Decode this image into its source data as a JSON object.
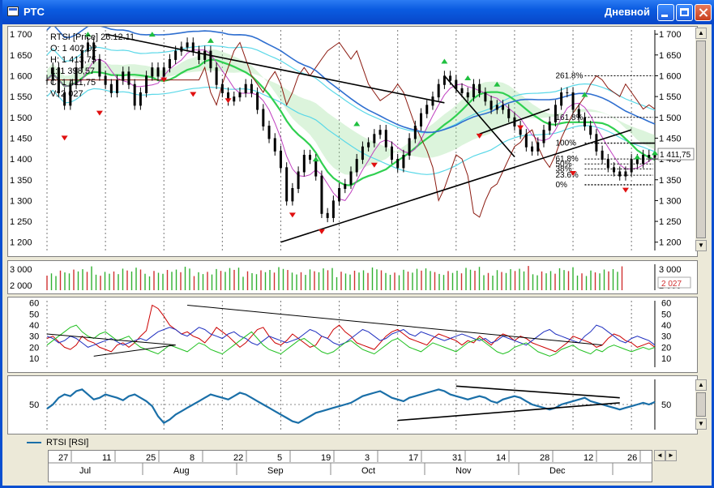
{
  "window": {
    "title": "РТС",
    "period": "Дневной"
  },
  "legend": {
    "rsi": "RTSI [RSI]"
  },
  "chart_data": [
    {
      "type": "candlestick",
      "title": "RTSI [Price] 26.12.11",
      "ohlc": {
        "O": "1 402,02",
        "H": "1 413,75",
        "L": "1 398,57",
        "C": "1 411,75",
        "V": "2 027"
      },
      "ylim": [
        1180,
        1710
      ],
      "yticks": [
        1200,
        1250,
        1300,
        1350,
        1400,
        1450,
        1500,
        1550,
        1600,
        1650,
        1700
      ],
      "ytick_labels": [
        "1 200",
        "1 250",
        "1 300",
        "1 350",
        "1 400",
        "1 450",
        "1 500",
        "1 550",
        "1 600",
        "1 650",
        "1 700"
      ],
      "last_value_label": "1 411,75",
      "last_value": 1411.75,
      "fib_levels": [
        {
          "label": "261.8%",
          "value": 1600
        },
        {
          "label": "161.8%",
          "value": 1500
        },
        {
          "label": "100%",
          "value": 1438
        },
        {
          "label": "61.8%",
          "value": 1400
        },
        {
          "label": "50%",
          "value": 1388
        },
        {
          "label": "38%",
          "value": 1376
        },
        {
          "label": "23.6%",
          "value": 1361
        },
        {
          "label": "0%",
          "value": 1338
        }
      ],
      "closes": [
        1590,
        1620,
        1560,
        1530,
        1580,
        1620,
        1660,
        1680,
        1640,
        1600,
        1580,
        1560,
        1590,
        1610,
        1580,
        1530,
        1560,
        1600,
        1620,
        1600,
        1620,
        1640,
        1660,
        1670,
        1680,
        1660,
        1640,
        1660,
        1620,
        1580,
        1560,
        1540,
        1550,
        1560,
        1580,
        1560,
        1520,
        1480,
        1450,
        1420,
        1380,
        1300,
        1330,
        1370,
        1410,
        1400,
        1360,
        1270,
        1260,
        1300,
        1330,
        1340,
        1370,
        1400,
        1430,
        1440,
        1460,
        1470,
        1430,
        1400,
        1380,
        1410,
        1450,
        1480,
        1510,
        1530,
        1550,
        1580,
        1600,
        1590,
        1570,
        1560,
        1550,
        1580,
        1560,
        1540,
        1520,
        1530,
        1520,
        1500,
        1480,
        1460,
        1430,
        1420,
        1440,
        1470,
        1490,
        1530,
        1560,
        1560,
        1520,
        1500,
        1480,
        1460,
        1420,
        1400,
        1380,
        1370,
        1360,
        1370,
        1400,
        1390,
        1410,
        1405,
        1412
      ],
      "signals": [
        {
          "dir": "up",
          "i": 7,
          "value": 1700
        },
        {
          "dir": "down",
          "i": 3,
          "value": 1450
        },
        {
          "dir": "down",
          "i": 9,
          "value": 1510
        },
        {
          "dir": "up",
          "i": 18,
          "value": 1700
        },
        {
          "dir": "down",
          "i": 20,
          "value": 1590
        },
        {
          "dir": "down",
          "i": 25,
          "value": 1555
        },
        {
          "dir": "down",
          "i": 31,
          "value": 1540
        },
        {
          "dir": "up",
          "i": 28,
          "value": 1685
        },
        {
          "dir": "down",
          "i": 42,
          "value": 1265
        },
        {
          "dir": "up",
          "i": 46,
          "value": 1400
        },
        {
          "dir": "down",
          "i": 47,
          "value": 1225
        },
        {
          "dir": "up",
          "i": 53,
          "value": 1485
        },
        {
          "dir": "down",
          "i": 56,
          "value": 1385
        },
        {
          "dir": "up",
          "i": 68,
          "value": 1635
        },
        {
          "dir": "up",
          "i": 72,
          "value": 1595
        },
        {
          "dir": "down",
          "i": 74,
          "value": 1455
        },
        {
          "dir": "up",
          "i": 77,
          "value": 1580
        },
        {
          "dir": "down",
          "i": 81,
          "value": 1475
        },
        {
          "dir": "down",
          "i": 90,
          "value": 1365
        },
        {
          "dir": "up",
          "i": 92,
          "value": 1555
        },
        {
          "dir": "down",
          "i": 99,
          "value": 1325
        },
        {
          "dir": "up",
          "i": 101,
          "value": 1405
        },
        {
          "dir": "up",
          "i": 104,
          "value": 1415
        }
      ]
    },
    {
      "type": "bar",
      "title": "Volume",
      "yticks": [
        2000,
        3000
      ],
      "ytick_labels": [
        "2 000",
        "3 000"
      ],
      "ylim": [
        1700,
        3300
      ],
      "last_value_label": "2 027",
      "pattern": [
        2600,
        2700,
        2500,
        2800,
        2650,
        2550,
        2750
      ]
    },
    {
      "type": "line",
      "title": "DMI",
      "ylim": [
        2,
        62
      ],
      "yticks": [
        10,
        20,
        30,
        40,
        50,
        60
      ],
      "series": [
        {
          "color": "#CC0000",
          "values": [
            28,
            30,
            25,
            20,
            18,
            22,
            30,
            26,
            24,
            20,
            18,
            16,
            22,
            24,
            20,
            24,
            30,
            35,
            58,
            55,
            48,
            40,
            36,
            32,
            34,
            30,
            28,
            24,
            30,
            38,
            34,
            30,
            25,
            20,
            24,
            30,
            36,
            38,
            30,
            24,
            22,
            26,
            32,
            28,
            24,
            20,
            22,
            30,
            28,
            36,
            40,
            34,
            30,
            24,
            22,
            20,
            18,
            24,
            30,
            34,
            36,
            32,
            28,
            26,
            24,
            22,
            28,
            32,
            30,
            28,
            26,
            22,
            26,
            24,
            30,
            26,
            22,
            28,
            32,
            30,
            26,
            30,
            28,
            24,
            22,
            20,
            18,
            16,
            20,
            24,
            30,
            28,
            26,
            24,
            20,
            22,
            28,
            32,
            30,
            26,
            24,
            20,
            22,
            24,
            20
          ]
        },
        {
          "color": "#2030C0",
          "values": [
            30,
            28,
            24,
            26,
            30,
            28,
            24,
            20,
            22,
            24,
            26,
            28,
            25,
            22,
            24,
            26,
            28,
            26,
            30,
            34,
            36,
            38,
            36,
            32,
            30,
            34,
            38,
            36,
            32,
            30,
            28,
            32,
            34,
            30,
            28,
            24,
            22,
            26,
            30,
            28,
            26,
            24,
            26,
            28,
            32,
            36,
            34,
            30,
            28,
            24,
            22,
            24,
            28,
            32,
            36,
            34,
            30,
            26,
            28,
            32,
            34,
            36,
            32,
            30,
            34,
            32,
            30,
            28,
            26,
            28,
            30,
            32,
            30,
            28,
            26,
            28,
            24,
            26,
            30,
            28,
            26,
            24,
            22,
            26,
            30,
            34,
            36,
            32,
            30,
            28,
            26,
            24,
            30,
            34,
            40,
            38,
            34,
            30,
            26,
            24,
            28,
            30,
            28,
            26,
            22
          ]
        },
        {
          "color": "#20C020",
          "values": [
            22,
            26,
            30,
            34,
            38,
            40,
            34,
            30,
            28,
            32,
            34,
            30,
            26,
            28,
            30,
            24,
            20,
            18,
            16,
            14,
            18,
            22,
            20,
            18,
            16,
            20,
            24,
            22,
            18,
            16,
            14,
            18,
            22,
            26,
            30,
            34,
            28,
            22,
            18,
            16,
            14,
            18,
            22,
            26,
            28,
            24,
            20,
            16,
            14,
            16,
            20,
            24,
            26,
            22,
            18,
            16,
            14,
            18,
            22,
            26,
            28,
            24,
            20,
            18,
            16,
            20,
            24,
            22,
            20,
            18,
            16,
            20,
            24,
            26,
            28,
            24,
            20,
            16,
            14,
            16,
            20,
            22,
            24,
            20,
            16,
            14,
            12,
            14,
            18,
            20,
            22,
            18,
            16,
            14,
            18,
            16,
            20,
            22,
            20,
            18,
            16,
            18,
            20,
            18,
            20
          ]
        }
      ],
      "trendlines": [
        {
          "from": [
            0,
            32
          ],
          "to": [
            22,
            22
          ]
        },
        {
          "from": [
            8,
            12
          ],
          "to": [
            22,
            22
          ]
        },
        {
          "from": [
            24,
            58
          ],
          "to": [
            95,
            22
          ]
        }
      ]
    },
    {
      "type": "line",
      "title": "RTSI [RSI]",
      "ylim": [
        20,
        80
      ],
      "yticks": [
        50
      ],
      "ytick_labels": [
        "50"
      ],
      "series": [
        {
          "name": "RTSI [RSI]",
          "color": "#1A6FA8",
          "values": [
            45,
            50,
            58,
            62,
            60,
            66,
            68,
            62,
            56,
            58,
            62,
            60,
            58,
            55,
            60,
            62,
            58,
            54,
            48,
            36,
            28,
            32,
            38,
            42,
            46,
            50,
            54,
            58,
            62,
            60,
            58,
            56,
            60,
            64,
            62,
            58,
            54,
            50,
            46,
            42,
            38,
            34,
            30,
            28,
            32,
            36,
            40,
            42,
            44,
            46,
            48,
            50,
            52,
            56,
            60,
            62,
            64,
            66,
            62,
            58,
            56,
            54,
            58,
            60,
            62,
            64,
            66,
            68,
            66,
            62,
            60,
            58,
            56,
            58,
            60,
            58,
            54,
            52,
            56,
            58,
            60,
            58,
            54,
            50,
            48,
            46,
            44,
            46,
            50,
            52,
            54,
            56,
            58,
            54,
            52,
            50,
            48,
            46,
            44,
            46,
            48,
            50,
            52,
            50,
            53
          ]
        }
      ],
      "trendlines": [
        {
          "from": [
            60,
            31
          ],
          "to": [
            98,
            52
          ]
        },
        {
          "from": [
            70,
            72
          ],
          "to": [
            98,
            58
          ]
        }
      ]
    }
  ],
  "time_axis": {
    "day_labels": [
      "27",
      "11",
      "25",
      "8",
      "22",
      "5",
      "19",
      "3",
      "17",
      "31",
      "14",
      "28",
      "12",
      "26"
    ],
    "month_labels": [
      "Jul",
      "Aug",
      "Sep",
      "Oct",
      "Nov",
      "Dec"
    ]
  }
}
